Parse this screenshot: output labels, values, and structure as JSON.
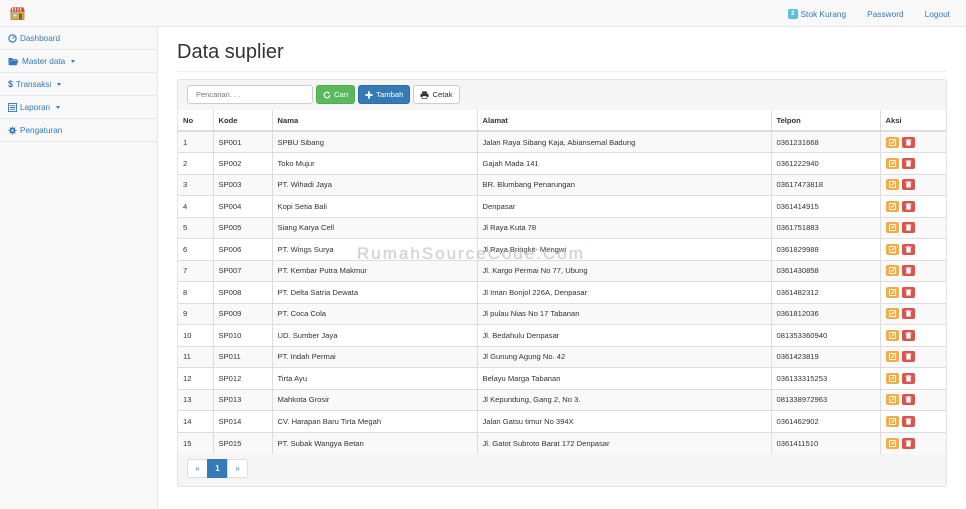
{
  "topnav": {
    "badge": "2",
    "stok_label": "Stok Kurang",
    "password_label": "Password",
    "logout_label": "Logout"
  },
  "sidebar": {
    "items": [
      {
        "label": "Dashboard",
        "icon": "dashboard-icon"
      },
      {
        "label": "Master data",
        "icon": "folder-open-icon"
      },
      {
        "label": "Transaksi",
        "icon": "dollar-icon"
      },
      {
        "label": "Laporan",
        "icon": "list-icon"
      },
      {
        "label": "Pengaturan",
        "icon": "gear-icon"
      }
    ]
  },
  "page": {
    "title": "Data suplier"
  },
  "toolbar": {
    "search_placeholder": "Pencarian. . .",
    "cari_label": "Cari",
    "tambah_label": "Tambah",
    "cetak_label": "Cetak"
  },
  "table": {
    "columns": [
      "No",
      "Kode",
      "Nama",
      "Alamat",
      "Telpon",
      "Aksi"
    ],
    "rows": [
      [
        "1",
        "SP001",
        "SPBU Sibang",
        "Jalan Raya Sibang Kaja, Abiansemal Badung",
        "0361231668"
      ],
      [
        "2",
        "SP002",
        "Toko Mujur",
        "Gajah Mada 141",
        "0361222940"
      ],
      [
        "3",
        "SP003",
        "PT. Wihadi Jaya",
        "BR. Blumbang Penarungan",
        "03617473818"
      ],
      [
        "4",
        "SP004",
        "Kopi Setia Bali",
        "Denpasar",
        "0361414915"
      ],
      [
        "5",
        "SP005",
        "Siang Karya Cell",
        "Jl Raya Kuta 78",
        "0361751883"
      ],
      [
        "6",
        "SP006",
        "PT. Wings Surya",
        "Jl Raya Bringkit- Mengwi",
        "0361829988"
      ],
      [
        "7",
        "SP007",
        "PT. Kembar Putra Makmur",
        "Jl. Kargo Permai No 77, Ubung",
        "0361430858"
      ],
      [
        "8",
        "SP008",
        "PT. Delta Satria Dewata",
        "Jl Iman Bonjol 226A, Denpasar",
        "0361482312"
      ],
      [
        "9",
        "SP009",
        "PT. Coca Cola",
        "Jl pulau Nias No 17 Tabanan",
        "0361812036"
      ],
      [
        "10",
        "SP010",
        "UD. Sumber Jaya",
        "Jl. Bedahulu Denpasar",
        "081353360940"
      ],
      [
        "11",
        "SP011",
        "PT. Indah Permai",
        "Jl Gunung Agung No. 42",
        "0361423819"
      ],
      [
        "12",
        "SP012",
        "Tirta Ayu",
        "Belayu Marga Tabanan",
        "036133315253"
      ],
      [
        "13",
        "SP013",
        "Mahkota Grosir",
        "Jl Kepundung, Gang 2, No 3.",
        "081338972963"
      ],
      [
        "14",
        "SP014",
        "CV. Harapan Baru Tirta Megah",
        "Jalan Gatsu timur No 394X",
        "0361462902"
      ],
      [
        "15",
        "SP015",
        "PT. Subak Wangya Betan",
        "Jl. Gatot Subroto Barat 172 Denpasar",
        "0361411510"
      ]
    ]
  },
  "pagination": {
    "prev": "«",
    "current": "1",
    "next": "»"
  },
  "watermark": "RumahSourceCode.Com",
  "colors": {
    "primary": "#337ab7",
    "success": "#5cb85c",
    "warning": "#f0ad4e",
    "danger": "#d9534f",
    "info": "#5bc0de"
  }
}
